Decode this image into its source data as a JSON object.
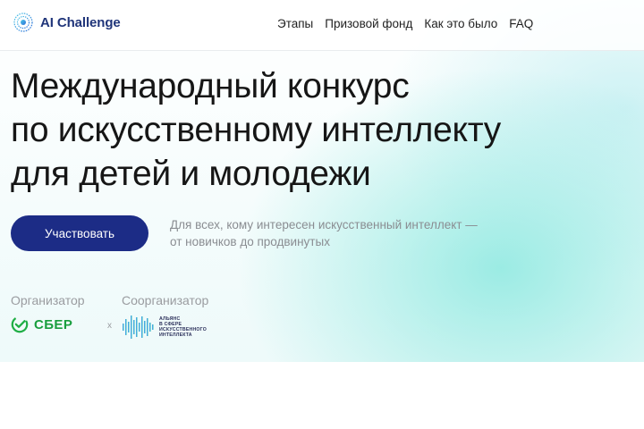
{
  "header": {
    "logo_text": "AI Challenge",
    "nav": [
      "Этапы",
      "Призовой фонд",
      "Как это было",
      "FAQ"
    ]
  },
  "hero": {
    "title_lines": [
      "Международный конкурс",
      "по искусственному интеллекту",
      "для детей и молодежи"
    ],
    "cta_label": "Участвовать",
    "subtext_lines": [
      "Для всех, кому интересен искусственный интеллект —",
      "от новичков до продвинутых"
    ]
  },
  "organizers": {
    "organizer_label": "Организатор",
    "coorganizer_label": "Соорганизатор",
    "sber_text": "СБЕР",
    "separator": "x",
    "alliance_lines": [
      "АЛЬЯНС",
      "В СФЕРЕ",
      "ИСКУССТВЕННОГО",
      "ИНТЕЛЛЕКТА"
    ]
  },
  "colors": {
    "brand_dark": "#1c2c86",
    "logo_text": "#20357a",
    "sber_green": "#199e3e",
    "muted_text": "#8a8d92"
  }
}
